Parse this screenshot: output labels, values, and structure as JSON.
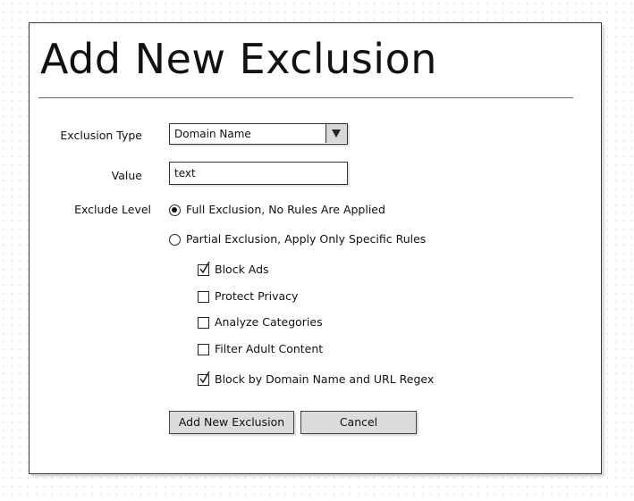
{
  "dialog": {
    "title": "Add New Exclusion"
  },
  "form": {
    "exclusion_type": {
      "label": "Exclusion Type",
      "selected": "Domain Name"
    },
    "value": {
      "label": "Value",
      "input_value": "text"
    },
    "exclude_level": {
      "label": "Exclude Level",
      "options": [
        {
          "label": "Full Exclusion, No Rules Are Applied",
          "selected": true
        },
        {
          "label": "Partial Exclusion, Apply Only Specific Rules",
          "selected": false
        }
      ]
    },
    "rules": [
      {
        "label": "Block Ads",
        "checked": true
      },
      {
        "label": "Protect Privacy",
        "checked": false
      },
      {
        "label": "Analyze Categories",
        "checked": false
      },
      {
        "label": "Filter Adult Content",
        "checked": false
      },
      {
        "label": "Block by Domain Name and URL Regex",
        "checked": true
      }
    ]
  },
  "buttons": {
    "submit_label": "Add New Exclusion",
    "cancel_label": "Cancel"
  },
  "icons": {
    "dropdown": "triangle-down-icon",
    "check": "check-mark-icon"
  },
  "colors": {
    "button_face": "#dcdcdc",
    "dropdown_button": "#d8d8d8",
    "border": "#333333"
  }
}
